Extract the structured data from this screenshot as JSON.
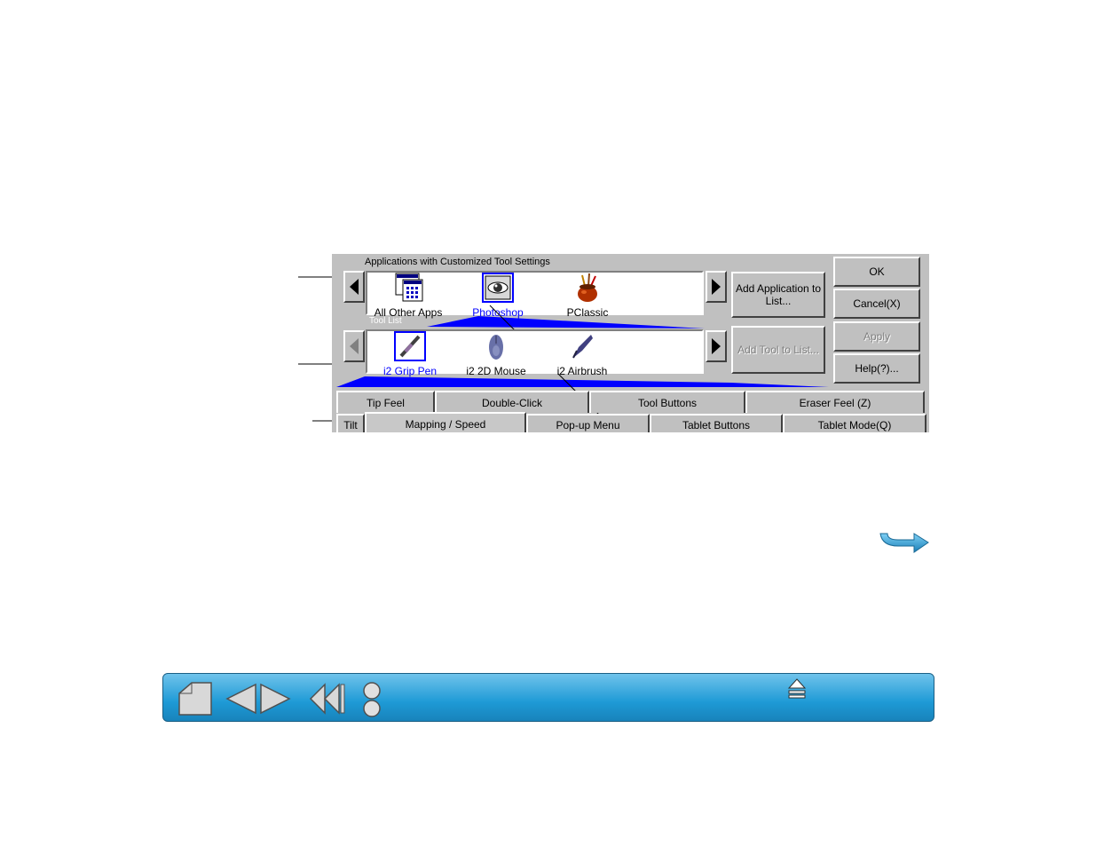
{
  "dialog": {
    "apps_label": "Applications with Customized Tool Settings",
    "applications": [
      {
        "label": "All Other Apps",
        "icon": "all-apps-icon",
        "selected": false
      },
      {
        "label": "Photoshop",
        "icon": "eye-icon",
        "selected": true
      },
      {
        "label": "PClassic",
        "icon": "paint-pot-icon",
        "selected": false
      }
    ],
    "tool_list_label": "Tool List",
    "tools": [
      {
        "label": "i2 Grip Pen",
        "icon": "pen-icon",
        "selected": true
      },
      {
        "label": "i2 2D Mouse",
        "icon": "mouse-icon",
        "selected": false
      },
      {
        "label": "i2 Airbrush",
        "icon": "airbrush-icon",
        "selected": false
      }
    ],
    "buttons": {
      "add_application": "Add Application to List...",
      "add_tool": "Add Tool to List...",
      "ok": "OK",
      "cancel": "Cancel(X)",
      "apply": "Apply",
      "help": "Help(?)..."
    },
    "tabs_row1": [
      "Tip Feel",
      "Double-Click",
      "Tool Buttons",
      "Eraser Feel (Z)"
    ],
    "tabs_row2": [
      "Tilt",
      "Mapping / Speed",
      "Pop-up Menu",
      "Tablet Buttons",
      "Tablet Mode(Q)"
    ],
    "active_tab": "Mapping / Speed"
  },
  "nav": {
    "icons": [
      "home-icon",
      "previous-page-icon",
      "next-page-icon",
      "back-icon",
      "index-icon",
      "contents-icon",
      "eject-icon",
      "next-arrow-icon"
    ]
  },
  "colors": {
    "highlight": "#0000ff",
    "navbar": "#1e9ad6",
    "panel": "#c0c0c0"
  }
}
